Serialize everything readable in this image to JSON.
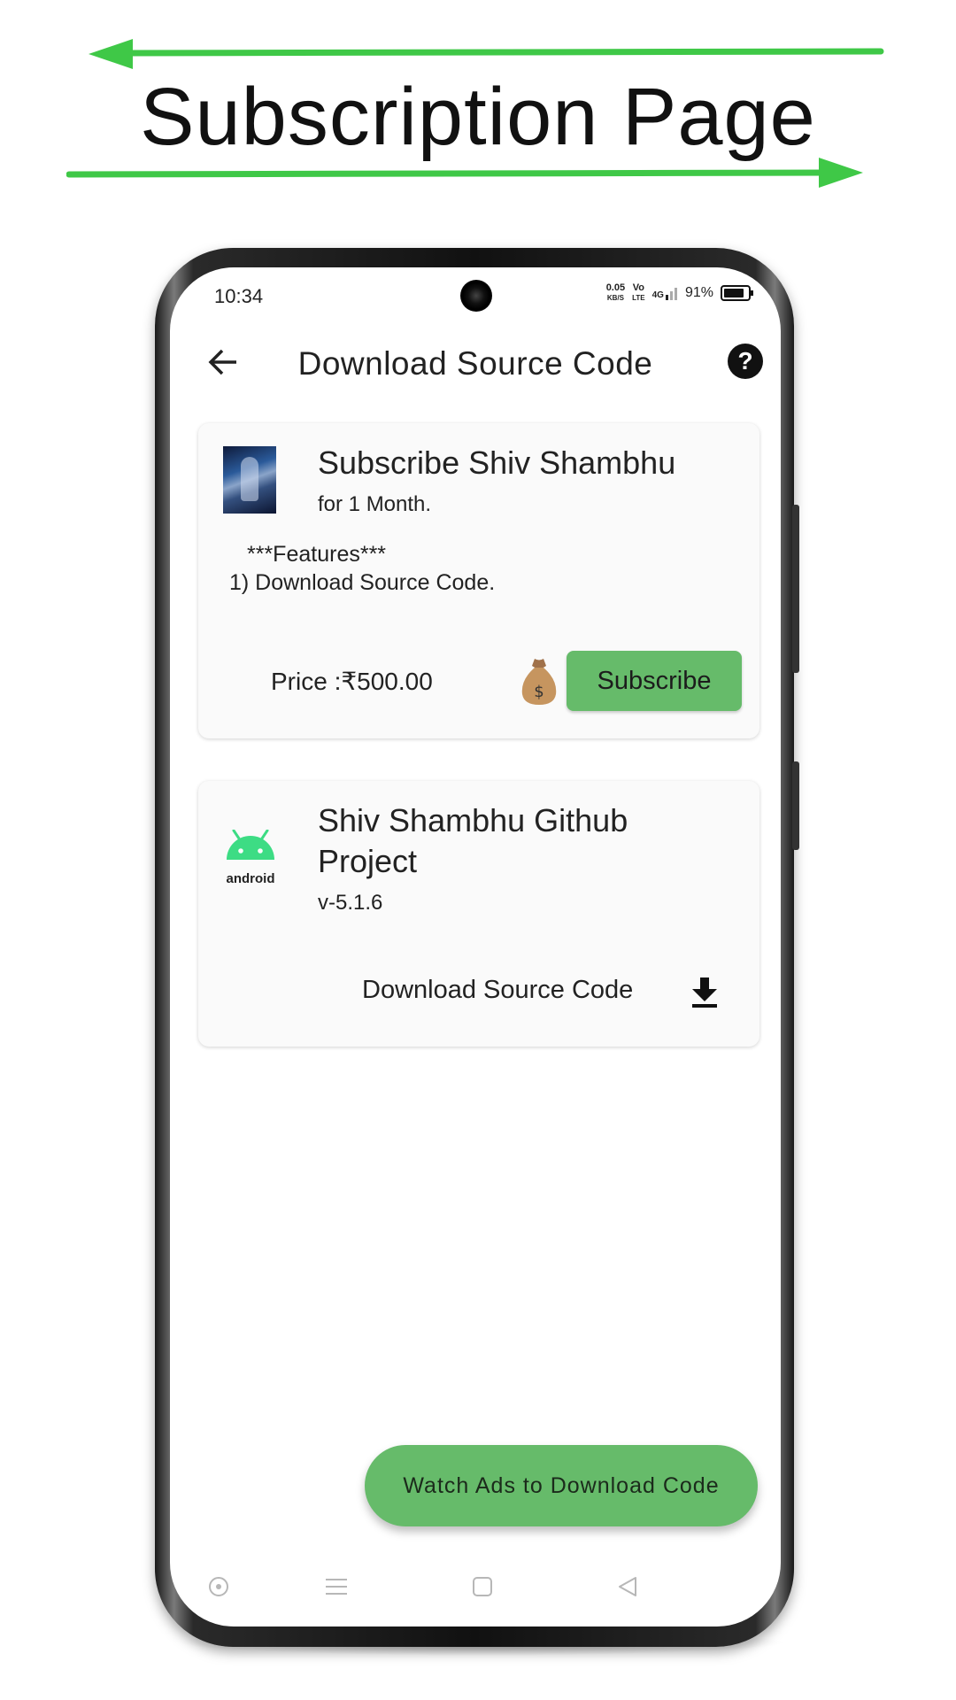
{
  "headline": "Subscription Page",
  "colors": {
    "arrow": "#3fc847",
    "accent": "#66bb6a"
  },
  "status_bar": {
    "time": "10:34",
    "speed": "0.05",
    "speed_unit": "KB/S",
    "volte_top": "Vo",
    "volte_bottom": "LTE",
    "network": "4G",
    "battery": "91%"
  },
  "app_bar": {
    "title": "Download Source Code",
    "back_icon": "arrow-left-icon",
    "help_icon": "help-circle-icon"
  },
  "subscription_card": {
    "title": "Subscribe Shiv Shambhu",
    "subtitle": "for 1 Month.",
    "features_heading": "***Features***",
    "features": [
      "1) Download Source Code."
    ],
    "price": "Price :₹500.00",
    "button": "Subscribe",
    "icon": "money-bag-icon"
  },
  "project_card": {
    "title_line1": "Shiv Shambhu Github",
    "title_line2": "Project",
    "version": "v-5.1.6",
    "logo_text": "android",
    "download_label": "Download Source Code",
    "download_icon": "download-icon"
  },
  "fab": {
    "label": "Watch Ads to Download Code"
  },
  "nav_bar": {
    "icons": [
      "circle-dot-icon",
      "menu-icon",
      "home-square-icon",
      "back-triangle-icon"
    ]
  }
}
